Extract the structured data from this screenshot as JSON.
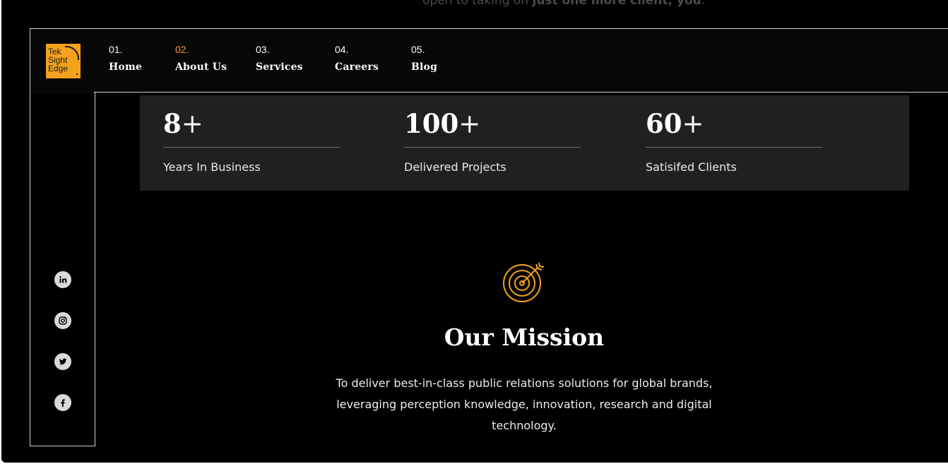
{
  "top_fade_text": {
    "pre": "open to taking on ",
    "bold": "just one more client, you",
    "post": "."
  },
  "logo": {
    "line1": "Tek",
    "line2": "Sight",
    "line3": "Edge"
  },
  "nav": {
    "items": [
      {
        "num": "01.",
        "label": "Home",
        "active": false
      },
      {
        "num": "02.",
        "label": "About Us",
        "active": true
      },
      {
        "num": "03.",
        "label": "Services",
        "active": false
      },
      {
        "num": "04.",
        "label": "Careers",
        "active": false
      },
      {
        "num": "05.",
        "label": "Blog",
        "active": false
      }
    ]
  },
  "social": [
    "linkedin-icon",
    "instagram-icon",
    "twitter-icon",
    "facebook-icon"
  ],
  "stats": [
    {
      "value": "8",
      "suffix": "+",
      "label": "Years In Business"
    },
    {
      "value": "100",
      "suffix": "+",
      "label": "Delivered Projects"
    },
    {
      "value": "60",
      "suffix": "+",
      "label": "Satisifed Clients"
    }
  ],
  "mission": {
    "title": "Our Mission",
    "text": "To deliver best-in-class public relations solutions for global brands, leveraging perception knowledge, innovation, research and digital technology."
  },
  "colors": {
    "accent": "#f4a11d",
    "background": "#000000",
    "panel": "#202020"
  }
}
